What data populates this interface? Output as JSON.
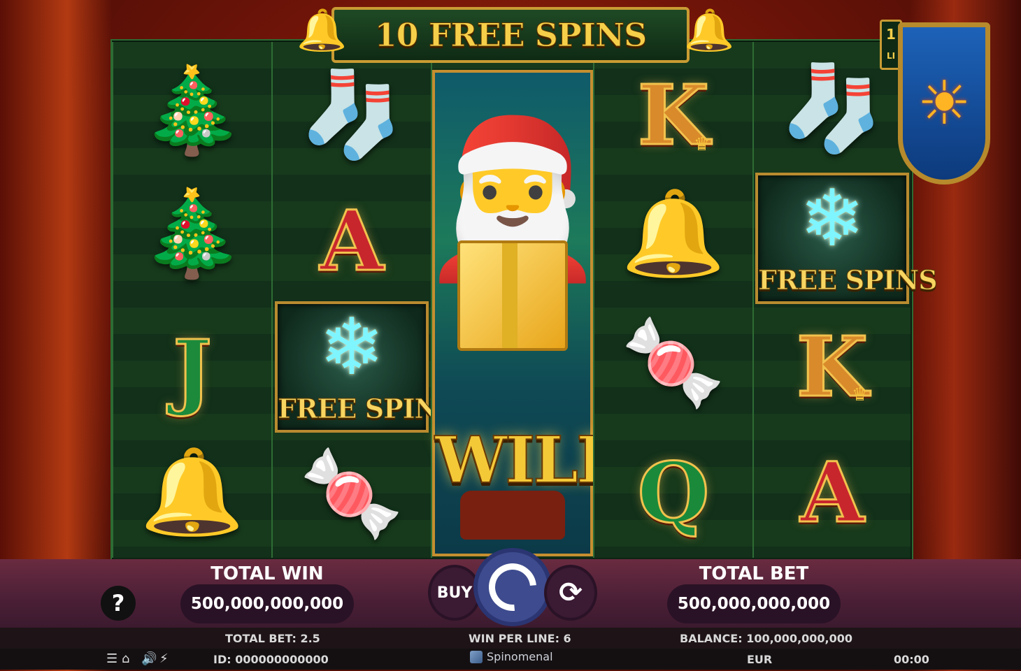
{
  "game": {
    "banner": "10 FREE SPINS",
    "side_tag": {
      "top": "1",
      "bottom": "LI"
    },
    "reels": [
      [
        "wreath",
        "wreath",
        "J",
        "bells"
      ],
      [
        "stocking",
        "A",
        "FREE SPINS",
        "candy-cane"
      ],
      [
        "WILD"
      ],
      [
        "K",
        "bells",
        "candy-cane",
        "Q"
      ],
      [
        "stocking",
        "FREE SPINS",
        "K",
        "A"
      ]
    ],
    "wild_label": "WILD",
    "free_spins_label": "FREE SPINS"
  },
  "controls": {
    "total_win_label": "TOTAL WIN",
    "total_win_value": "500,000,000,000",
    "total_bet_label": "TOTAL BET",
    "total_bet_value": "500,000,000,000",
    "help": "?",
    "buy": "BUY"
  },
  "info": {
    "total_bet": "TOTAL BET: 2.5",
    "win_per_line": "WIN PER LINE: 6",
    "balance": "BALANCE: 100,000,000,000",
    "id": "ID: 000000000000",
    "currency": "EUR",
    "time": "00:00",
    "brand": "Spinomenal"
  },
  "colors": {
    "accent_gold": "#f6cf4a",
    "reel_green": "#173a1c",
    "bar": "#4a1f36",
    "spin": "#3e4b8e"
  }
}
